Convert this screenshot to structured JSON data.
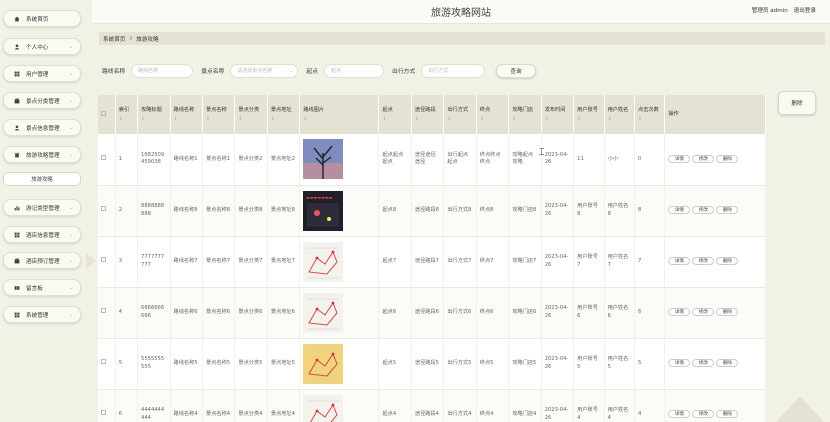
{
  "app": {
    "title": "旅游攻略网站",
    "user_label": "管理员 admin",
    "logout": "退出登录"
  },
  "sidebar": {
    "items": [
      {
        "label": "系统首页",
        "icon": "home-icon",
        "arrow": false
      },
      {
        "label": "个人中心",
        "icon": "user-icon",
        "arrow": true
      },
      {
        "label": "用户管理",
        "icon": "grid-icon",
        "arrow": true
      },
      {
        "label": "景点分类管理",
        "icon": "box-icon",
        "arrow": true
      },
      {
        "label": "景点信息管理",
        "icon": "user-icon",
        "arrow": true
      },
      {
        "label": "旅游攻略管理",
        "icon": "trash-icon",
        "arrow": true
      },
      {
        "label": "游记类型管理",
        "icon": "chart-icon",
        "arrow": true
      },
      {
        "label": "酒店信息管理",
        "icon": "grid-icon",
        "arrow": true
      },
      {
        "label": "酒店预订管理",
        "icon": "box-icon",
        "arrow": true
      },
      {
        "label": "留言板",
        "icon": "book-icon",
        "arrow": true
      },
      {
        "label": "系统管理",
        "icon": "grid-icon",
        "arrow": true
      }
    ],
    "sub_item": "旅游攻略"
  },
  "breadcrumb": {
    "home": "系统首页",
    "separator": "Ⅱ",
    "current": "旅游攻略"
  },
  "search": {
    "route_label": "路线名称",
    "route_placeholder": "路线名称",
    "spot_label": "景点名称",
    "spot_placeholder": "请选择景点名称",
    "start_label": "起点",
    "start_placeholder": "起点",
    "mode_label": "出行方式",
    "mode_placeholder": "出行方式",
    "search_button": "查询",
    "delete_button": "删除"
  },
  "table": {
    "sort_icon": "⇕",
    "headers": [
      "索引",
      "攻略标题",
      "路线名称",
      "景点名称",
      "景点分类",
      "景点地址",
      "路线图片",
      "起点",
      "途径路段",
      "出行方式",
      "终点",
      "攻略门店",
      "发布时间",
      "用户账号",
      "用户姓名",
      "点击次数",
      "操作"
    ],
    "action_buttons": [
      "详情",
      "修改",
      "删除"
    ],
    "rows": [
      {
        "idx": "1",
        "title": "1682509459038",
        "route": "路线名称1",
        "spot": "景点名称1",
        "cat": "景点分类2",
        "addr": "景点地址2",
        "img": "img-tree",
        "start": "起点起点起点",
        "via": "途径途径途径",
        "mode": "出行起点起点",
        "end": "终点终点终点",
        "store": "攻略起点攻略",
        "time": "2023-04-26",
        "acct": "11",
        "name": "小小",
        "clicks": "0"
      },
      {
        "idx": "2",
        "title": "8888888888",
        "route": "路线名称8",
        "spot": "景点名称8",
        "cat": "景点分类8",
        "addr": "景点地址8",
        "img": "img-dark",
        "start": "起点8",
        "via": "途径路段8",
        "mode": "出行方式8",
        "end": "终点8",
        "store": "攻略门店8",
        "time": "2023-04-26",
        "acct": "用户账号8",
        "name": "用户姓名8",
        "clicks": "8"
      },
      {
        "idx": "3",
        "title": "7777777777",
        "route": "路线名称7",
        "spot": "景点名称7",
        "cat": "景点分类7",
        "addr": "景点地址7",
        "img": "img-map1",
        "start": "起点7",
        "via": "途径路段7",
        "mode": "出行方式7",
        "end": "终点7",
        "store": "攻略门店7",
        "time": "2023-04-26",
        "acct": "用户账号7",
        "name": "用户姓名7",
        "clicks": "7"
      },
      {
        "idx": "4",
        "title": "6666666666",
        "route": "路线名称6",
        "spot": "景点名称6",
        "cat": "景点分类6",
        "addr": "景点地址6",
        "img": "img-map2",
        "start": "起点6",
        "via": "途径路段6",
        "mode": "出行方式6",
        "end": "终点6",
        "store": "攻略门店6",
        "time": "2023-04-26",
        "acct": "用户账号6",
        "name": "用户姓名6",
        "clicks": "6"
      },
      {
        "idx": "5",
        "title": "5555555555",
        "route": "路线名称5",
        "spot": "景点名称5",
        "cat": "景点分类5",
        "addr": "景点地址5",
        "img": "img-map3",
        "start": "起点5",
        "via": "途径路段5",
        "mode": "出行方式5",
        "end": "终点5",
        "store": "攻略门店5",
        "time": "2023-04-26",
        "acct": "用户账号5",
        "name": "用户姓名5",
        "clicks": "5"
      },
      {
        "idx": "6",
        "title": "4444444444",
        "route": "路线名称4",
        "spot": "景点名称4",
        "cat": "景点分类4",
        "addr": "景点地址4",
        "img": "img-map4",
        "start": "起点4",
        "via": "途径路段4",
        "mode": "出行方式4",
        "end": "终点4",
        "store": "攻略门店4",
        "time": "2023-04-26",
        "acct": "用户账号4",
        "name": "用户姓名4",
        "clicks": "4"
      }
    ]
  },
  "colors": {
    "background": "#f2f1e6",
    "header_row": "#e4e3d3",
    "accent": "#444444"
  }
}
